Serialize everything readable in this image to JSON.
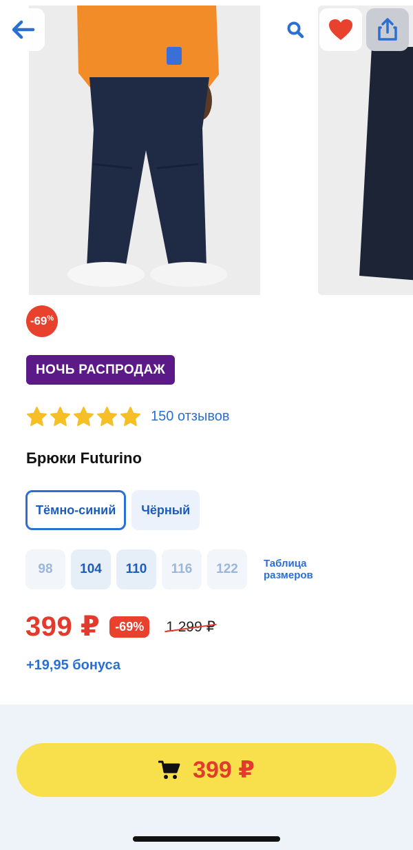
{
  "gallery": {
    "current_image_alt": "Брюки Futurino",
    "next_image_alt": "Брюки Futurino"
  },
  "header": {
    "back_icon": "arrow-left-icon",
    "search_icon": "search-icon",
    "favorite_icon": "heart-icon",
    "share_icon": "share-icon",
    "accent_color": "#2a6fd1",
    "favorite_color": "#e8412d"
  },
  "discount_circle": {
    "value": "-69",
    "unit": "%"
  },
  "promo_badge": {
    "label": "НОЧЬ РАСПРОДАЖ",
    "color": "#5b1a87"
  },
  "rating": {
    "stars": 5,
    "reviews_label": "150 отзывов"
  },
  "product": {
    "title": "Брюки Futurino"
  },
  "colors": [
    {
      "label": "Тёмно-синий",
      "selected": true
    },
    {
      "label": "Чёрный",
      "selected": false
    }
  ],
  "sizes": [
    {
      "label": "98",
      "available": false
    },
    {
      "label": "104",
      "available": true
    },
    {
      "label": "110",
      "available": true
    },
    {
      "label": "116",
      "available": false
    },
    {
      "label": "122",
      "available": false
    }
  ],
  "size_table_label": "Таблица размеров",
  "price": {
    "current": "399 ₽",
    "discount": "-69%",
    "old": "1 299 ₽",
    "color": "#e23b2d"
  },
  "bonus": {
    "label": "+19,95 бонуса"
  },
  "buy_button": {
    "price": "399 ₽",
    "icon": "cart-icon",
    "color": "#f7e04b"
  }
}
